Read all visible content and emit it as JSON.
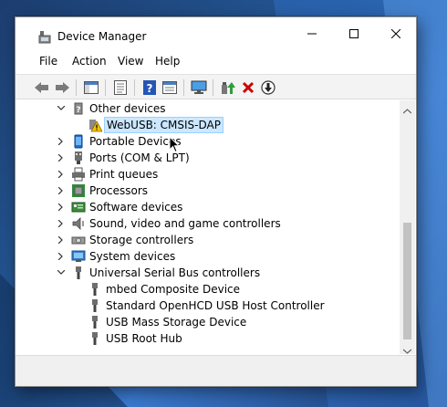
{
  "window": {
    "title": "Device Manager"
  },
  "controls": {
    "minimize": "minimize",
    "maximize": "maximize",
    "close": "close"
  },
  "menu": [
    "File",
    "Action",
    "View",
    "Help"
  ],
  "toolbar": {
    "icons": [
      "back-icon",
      "forward-icon",
      "show-hide-console-tree-icon",
      "properties-icon",
      "help-icon",
      "view-icon",
      "monitor-icon",
      "update-driver-icon",
      "uninstall-icon",
      "scan-hardware-icon"
    ]
  },
  "tree": {
    "other_devices": {
      "label": "Other devices",
      "children": [
        "WebUSB: CMSIS-DAP"
      ]
    },
    "categories": [
      "Portable Devices",
      "Ports (COM & LPT)",
      "Print queues",
      "Processors",
      "Software devices",
      "Sound, video and game controllers",
      "Storage controllers",
      "System devices"
    ],
    "usb": {
      "label": "Universal Serial Bus controllers",
      "children": [
        "mbed Composite Device",
        "Standard OpenHCD USB Host Controller",
        "USB Mass Storage Device",
        "USB Root Hub"
      ]
    }
  },
  "colors": {
    "selection": "#cce8ff",
    "warning": "#f5c400",
    "uninstall": "#cc0000",
    "accent": "#0078d7"
  }
}
